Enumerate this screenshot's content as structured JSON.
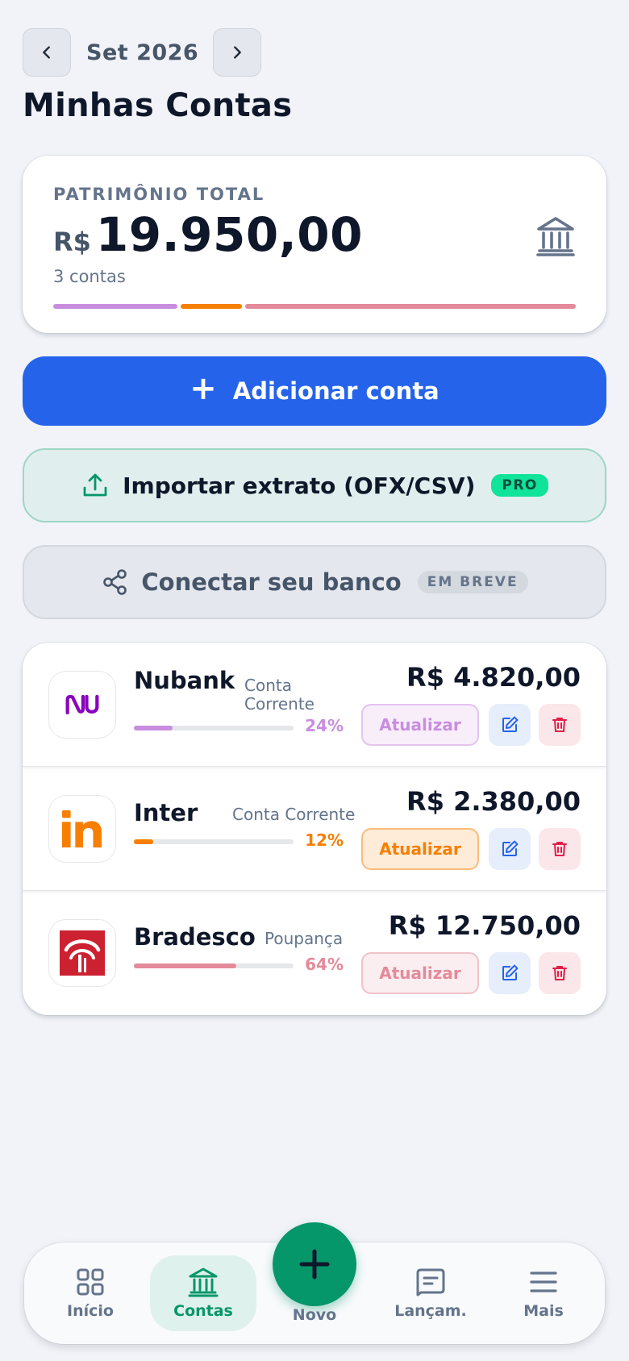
{
  "header": {
    "month": "Set 2026",
    "title": "Minhas Contas"
  },
  "total": {
    "kicker": "PATRIMÔNIO TOTAL",
    "currency": "R$",
    "value": "19.950,00",
    "count": "3 contas",
    "icon": "bank-icon",
    "share_shown_as_bar_fractions": [
      0.24,
      0.12,
      0.64
    ]
  },
  "actions": {
    "add_plus": "+",
    "add_label": "Adicionar conta",
    "import_label": "Importar extrato (OFX/CSV)",
    "import_badge": "PRO",
    "connect_label": "Conectar seu banco",
    "connect_badge": "EM BREVE"
  },
  "accounts": [
    {
      "name": "Nubank",
      "type": "Conta Corrente",
      "pct": "24%",
      "share": 0.24,
      "balance": "R$ 4.820,00",
      "update_label": "Atualizar",
      "color": "#c98de0",
      "logo": "nubank-logo"
    },
    {
      "name": "Inter",
      "type": "Conta Corrente",
      "pct": "12%",
      "share": 0.12,
      "balance": "R$ 2.380,00",
      "update_label": "Atualizar",
      "color": "#f77f00",
      "logo": "inter-logo"
    },
    {
      "name": "Bradesco",
      "type": "Poupança",
      "pct": "64%",
      "share": 0.64,
      "balance": "R$ 12.750,00",
      "update_label": "Atualizar",
      "color": "#e48a9a",
      "logo": "bradesco-logo"
    }
  ],
  "nav": {
    "items": [
      {
        "label": "Início",
        "icon": "grid-icon"
      },
      {
        "label": "Contas",
        "icon": "bank-icon",
        "active": true
      },
      {
        "label": "Novo",
        "icon": "plus-icon"
      },
      {
        "label": "Lançam.",
        "icon": "receipt-icon"
      },
      {
        "label": "Mais",
        "icon": "menu-icon"
      }
    ]
  },
  "colors": {
    "primary": "#2563eb",
    "accent": "#059669",
    "pro_badge": "#10e39a",
    "background": "#f1f3f8"
  }
}
